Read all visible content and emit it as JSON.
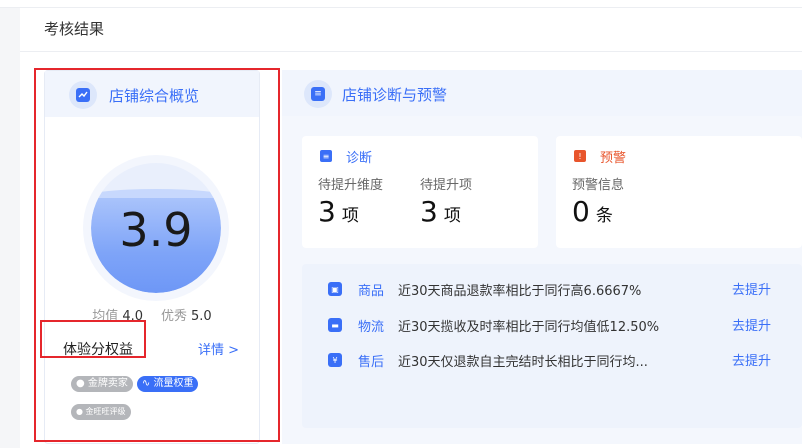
{
  "header": {
    "title": "考核结果"
  },
  "overview": {
    "title": "店铺综合概览",
    "score": "3.9",
    "score_level": 0.78,
    "avg_label": "均值",
    "avg_value": "4.0",
    "excellent_label": "优秀",
    "excellent_value": "5.0",
    "benefit_label": "体验分权益",
    "detail_link": "详情 >",
    "badges": [
      "金牌卖家",
      "流量权重",
      "金旺旺评级"
    ]
  },
  "diagnosis": {
    "section_title": "店铺诊断与预警",
    "diag_card": {
      "title": "诊断",
      "items": [
        {
          "label": "待提升维度",
          "value": "3",
          "unit": "项"
        },
        {
          "label": "待提升项",
          "value": "3",
          "unit": "项"
        }
      ]
    },
    "warn_card": {
      "title": "预警",
      "items": [
        {
          "label": "预警信息",
          "value": "0",
          "unit": "条"
        }
      ]
    },
    "list": [
      {
        "category": "商品",
        "text": "近30天商品退款率相比于同行高6.6667%",
        "action": "去提升"
      },
      {
        "category": "物流",
        "text": "近30天揽收及时率相比于同行均值低12.50%",
        "action": "去提升"
      },
      {
        "category": "售后",
        "text": "近30天仅退款自主完结时长相比于同行均...",
        "action": "去提升"
      }
    ]
  },
  "colors": {
    "accent": "#3a6ff7",
    "warning": "#e8552c",
    "highlight": "#e5262c"
  }
}
